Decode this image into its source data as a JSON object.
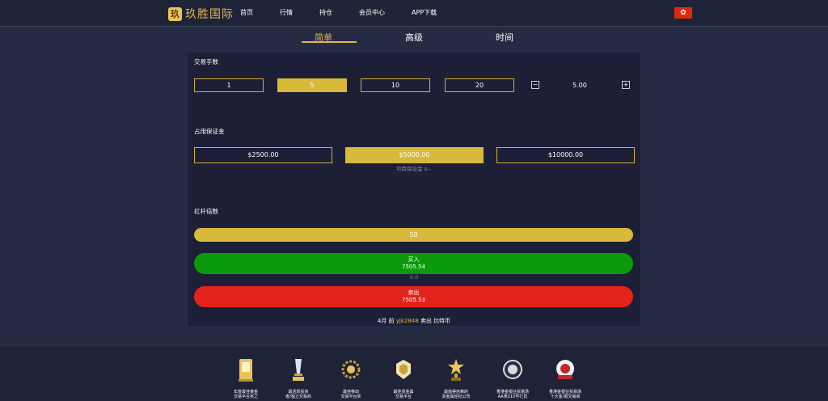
{
  "header": {
    "logo_text": "玖胜国际",
    "nav": [
      "首页",
      "行情",
      "持仓",
      "会员中心",
      "APP下载"
    ],
    "region_flag": "HK"
  },
  "tabs": [
    "简单",
    "高级",
    "时间"
  ],
  "lots": {
    "label": "交易手数",
    "options": [
      "1",
      "5",
      "10",
      "20"
    ],
    "selected": "5",
    "stepper_minus": "−",
    "stepper_value": "5.00",
    "stepper_plus": "+"
  },
  "margin": {
    "label": "占用保证金",
    "options": [
      "$2500.00",
      "$5000.00",
      "$10000.00"
    ],
    "selected": "$5000.00",
    "available": "可用保证金 $--"
  },
  "leverage": {
    "label": "杠杆倍数",
    "value": "50"
  },
  "buy": {
    "label": "买入",
    "price": "7505.54"
  },
  "spread": "0.0",
  "sell": {
    "label": "卖出",
    "price": "7505.53"
  },
  "feed": {
    "prefix": "4月 前",
    "user": "yjk2848",
    "suffix": "卖出 比特币"
  },
  "awards": [
    {
      "line1": "年度最佳黄金",
      "line2": "交易平台奖之"
    },
    {
      "line1": "最活跃投资",
      "line2": "者/独立交易商"
    },
    {
      "line1": "最佳移动",
      "line2": "交易平台奖"
    },
    {
      "line1": "最佳贵金属",
      "line2": "交易平台"
    },
    {
      "line1": "最值得信赖的",
      "line2": "贵金属经纪公司"
    },
    {
      "line1": "香港金银业贸易场",
      "line2": "AA类210号行员"
    },
    {
      "line1": "香港金银业贸易场",
      "line2": "十大金/银交易商"
    }
  ],
  "colors": {
    "gold": "#d8b93a",
    "buy": "#0a9a0a",
    "sell": "#e3231a",
    "bg": "#262b44",
    "panel": "#1c1f35"
  }
}
